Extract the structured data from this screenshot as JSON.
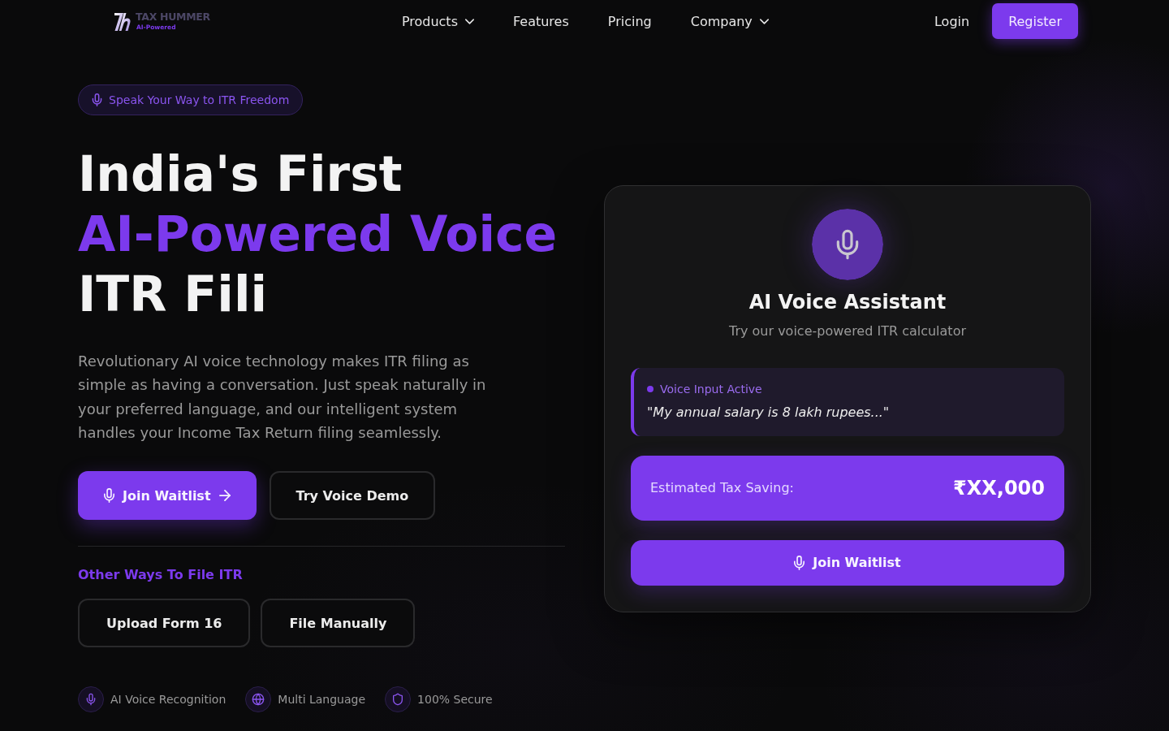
{
  "nav": {
    "logo": {
      "name": "TAX HUMMER",
      "tagline": "AI-Powered"
    },
    "links": [
      {
        "label": "Products",
        "dropdown": true
      },
      {
        "label": "Features",
        "dropdown": false
      },
      {
        "label": "Pricing",
        "dropdown": false
      },
      {
        "label": "Company",
        "dropdown": true
      }
    ],
    "login": "Login",
    "register": "Register"
  },
  "hero": {
    "badge": "Speak Your Way to ITR Freedom",
    "heading": [
      {
        "text": "India's First",
        "highlight": false
      },
      {
        "text": "AI-Powered Voice",
        "highlight": true
      },
      {
        "text": "ITR Fili",
        "highlight": false
      }
    ],
    "description": "Revolutionary AI voice technology makes ITR filing as simple as having a conversation. Just speak naturally in your preferred language, and our intelligent system handles your Income Tax Return filing seamlessly.",
    "actions": [
      {
        "label": "Join Waitlist",
        "kind": "primary"
      },
      {
        "label": "Try Voice Demo",
        "kind": "outline"
      }
    ],
    "other_ways": {
      "title": "Other Ways To File ITR",
      "options": [
        "Upload Form 16",
        "File Manually"
      ]
    },
    "features": [
      {
        "label": "AI Voice Recognition",
        "kind": "mic"
      },
      {
        "label": "Multi Language",
        "kind": "globe"
      },
      {
        "label": "100% Secure",
        "kind": "shield"
      }
    ]
  },
  "assistant_card": {
    "title": "AI Voice Assistant",
    "subtitle": "Try our voice-powered ITR calculator",
    "voice_input": {
      "status": "Voice Input Active",
      "active": true,
      "transcript": "\"My annual salary is 8 lakh rupees...\""
    },
    "estimate": {
      "label": "Estimated Tax Saving:",
      "value": "₹XX,000"
    },
    "cta": "Join Waitlist"
  }
}
